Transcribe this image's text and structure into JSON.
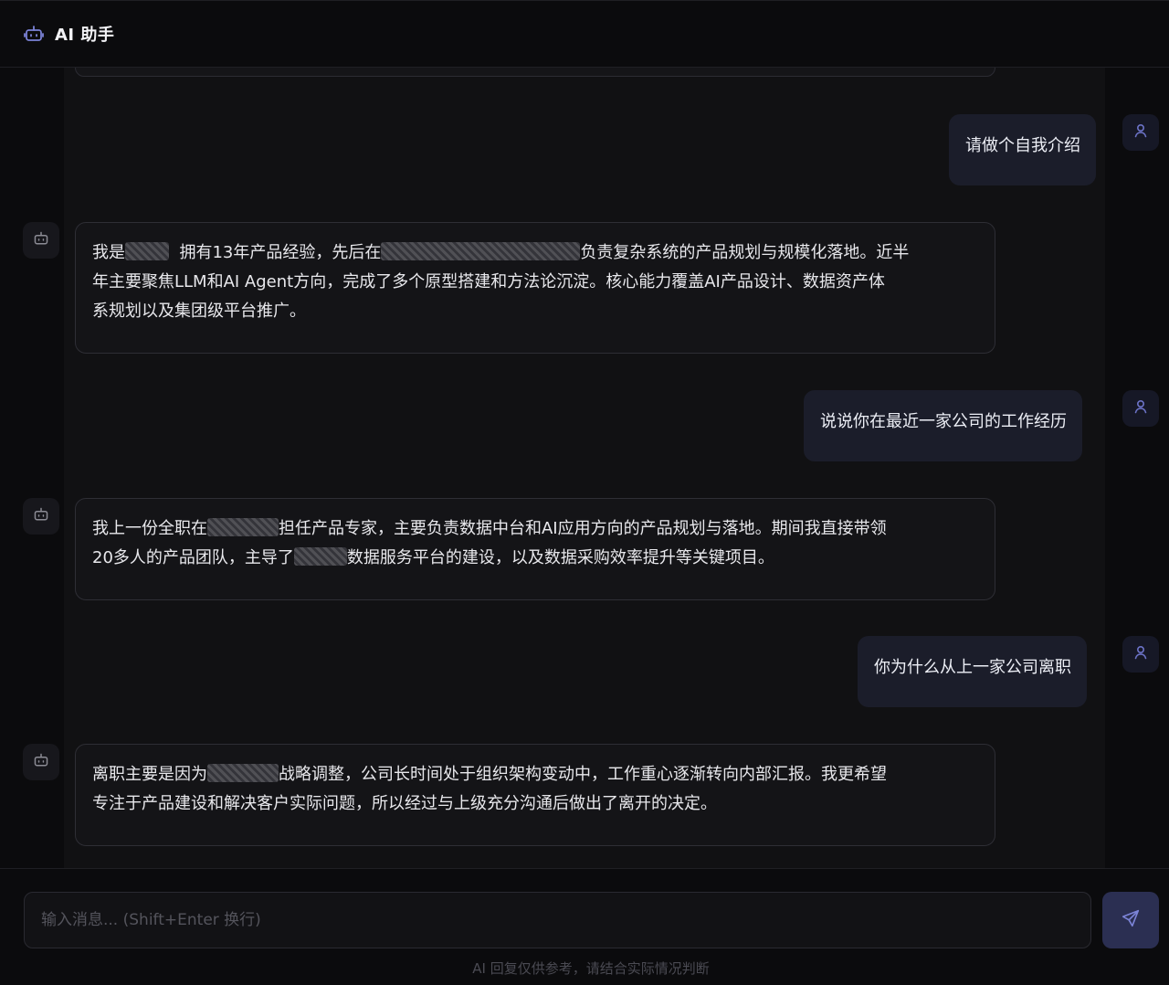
{
  "header": {
    "title": "AI 助手",
    "icon": "robot-icon"
  },
  "messages": [
    {
      "role": "user",
      "text": "请做个自我介绍"
    },
    {
      "role": "assistant",
      "line1_a": "我是",
      "line1_b": "拥有13年产品经验，先后在",
      "line1_c": "负责复杂系统的产品规划与规模化落地。近半",
      "line2": "年主要聚焦LLM和AI Agent方向，完成了多个原型搭建和方法论沉淀。核心能力覆盖AI产品设计、数据资产体",
      "line3": "系规划以及集团级平台推广。"
    },
    {
      "role": "user",
      "text": "说说你在最近一家公司的工作经历"
    },
    {
      "role": "assistant",
      "line1_a": "我上一份全职在",
      "line1_b": "担任产品专家，主要负责数据中台和AI应用方向的产品规划与落地。期间我直接带领",
      "line2_a": "20多人的产品团队，主导了",
      "line2_b": "数据服务平台的建设，以及数据采购效率提升等关键项目。"
    },
    {
      "role": "user",
      "text": "你为什么从上一家公司离职"
    },
    {
      "role": "assistant",
      "line1_a": "离职主要是因为",
      "line1_b": "战略调整，公司长时间处于组织架构变动中，工作重心逐渐转向内部汇报。我更希望",
      "line2": "专注于产品建设和解决客户实际问题，所以经过与上级充分沟通后做出了离开的决定。"
    }
  ],
  "composer": {
    "placeholder": "输入消息... (Shift+Enter 换行)",
    "value": "",
    "send_icon": "send-icon",
    "disclaimer": "AI 回复仅供参考，请结合实际情况判断"
  },
  "colors": {
    "background": "#0b0b0d",
    "user_bubble": "#1b1d2a",
    "send_button": "#2b2f52",
    "accent_icon": "#7b82d6"
  }
}
